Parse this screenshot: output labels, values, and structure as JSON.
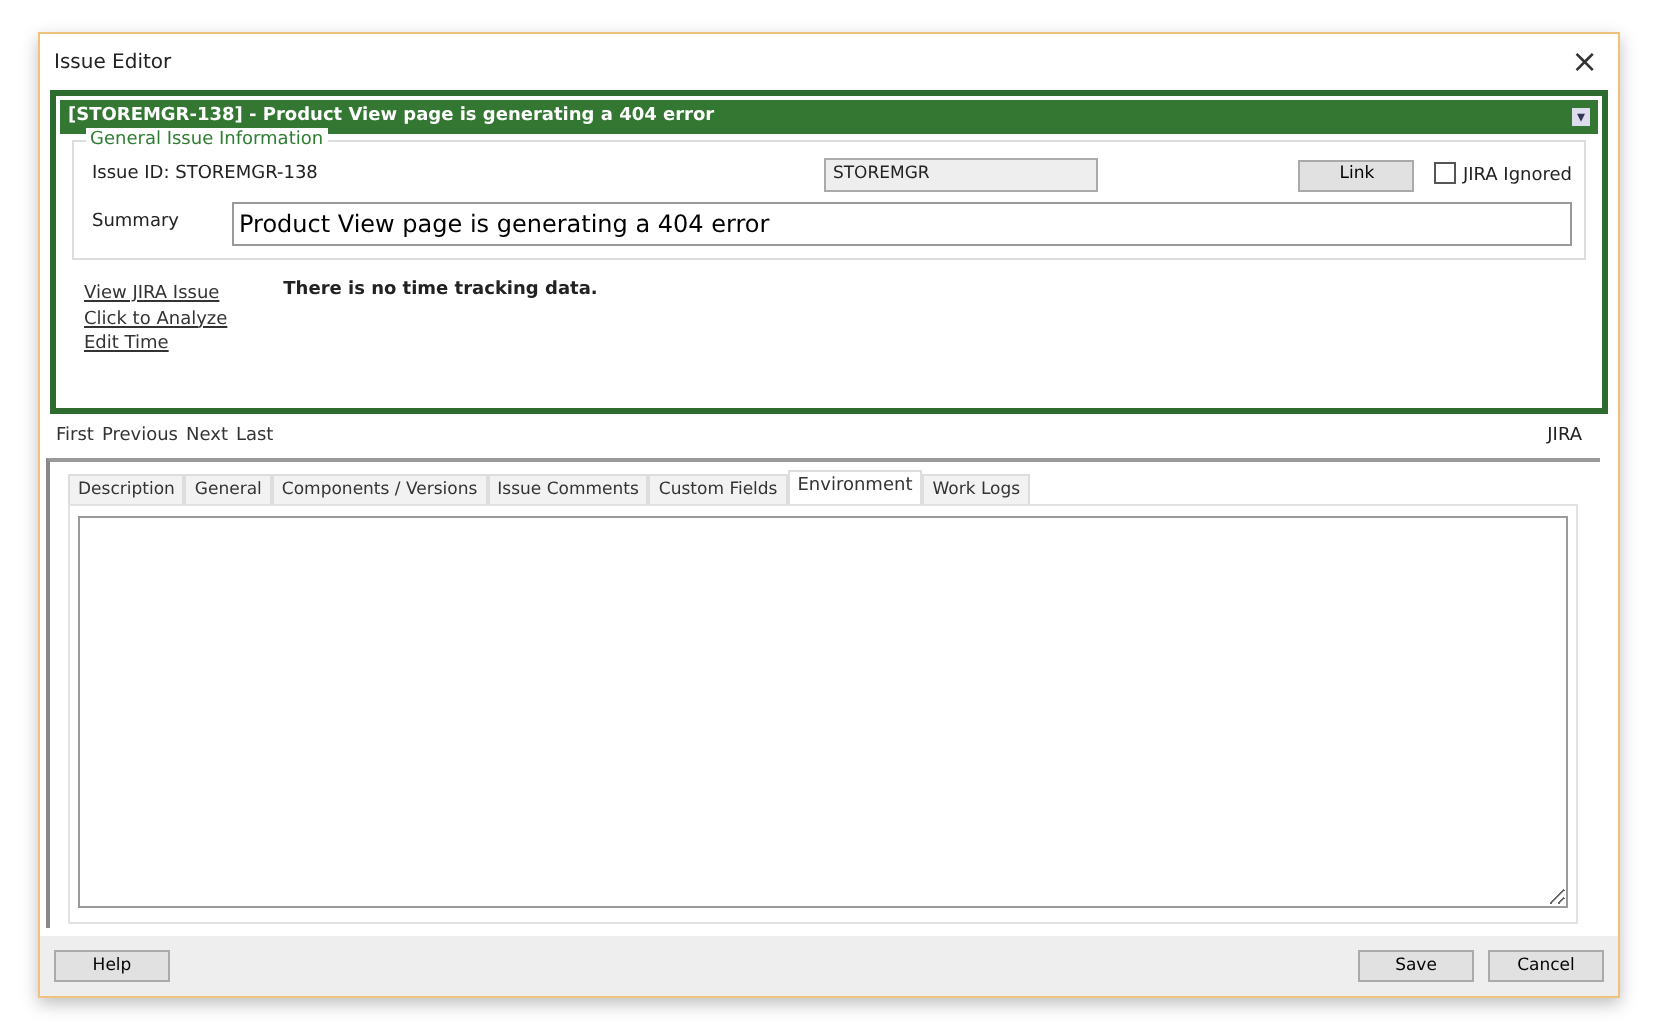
{
  "window": {
    "title": "Issue Editor",
    "close": "×"
  },
  "issue_panel": {
    "header": "[STOREMGR-138] - Product View page is generating a 404 error",
    "collapse": "▾",
    "group_title": "General Issue Information",
    "issue_id": "Issue ID: STOREMGR-138",
    "project": "STOREMGR",
    "link_button": "Link",
    "jira_ignored": {
      "label": "JIRA Ignored",
      "checked": false
    },
    "summary_label": "Summary",
    "summary": "Product View page is generating a 404 error",
    "links": [
      "View JIRA Issue",
      "Click to Analyze",
      "Edit Time"
    ],
    "time_tracking": "There is no time tracking data."
  },
  "navigation": [
    "First",
    "Previous",
    "Next",
    "Last"
  ],
  "source": "JIRA",
  "tabs": [
    {
      "label": "Description",
      "selected": false
    },
    {
      "label": "General",
      "selected": false
    },
    {
      "label": "Components / Versions",
      "selected": false
    },
    {
      "label": "Issue Comments",
      "selected": false
    },
    {
      "label": "Custom Fields",
      "selected": false
    },
    {
      "label": "Environment",
      "selected": true
    },
    {
      "label": "Work Logs",
      "selected": false
    }
  ],
  "buttons": {
    "left": [
      "Help"
    ],
    "right": [
      "Save",
      "Cancel"
    ]
  }
}
